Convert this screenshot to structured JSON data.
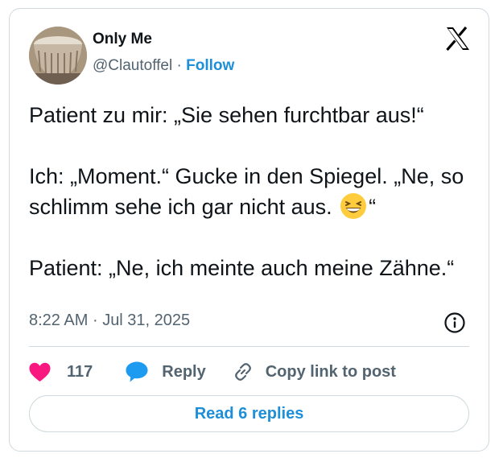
{
  "author": {
    "name": "Only Me",
    "handle": "@Clautoffel",
    "separator": "·",
    "follow_label": "Follow"
  },
  "post": {
    "line1": "Patient zu mir: „Sie sehen furchtbar aus!“",
    "line2_before_emoji": "Ich: „Moment.“ Gucke in den Spiegel. „Ne, so schlimm sehe ich gar nicht aus.",
    "line2_after_emoji": "“",
    "line3": "Patient: „Ne, ich meinte auch meine Zähne.“",
    "emoji_icon": "grinning-squinting-face-icon"
  },
  "meta": {
    "time": "8:22 AM",
    "separator": "·",
    "date": "Jul 31, 2025"
  },
  "actions": {
    "like_count": "117",
    "reply_label": "Reply",
    "copy_label": "Copy link to post",
    "read_replies_label": "Read 6 replies"
  },
  "colors": {
    "accent": "#1d8fd8",
    "heart": "#f91880",
    "reply_bubble": "#1d9bf0",
    "secondary_text": "#536471",
    "border": "#cfd9de"
  }
}
